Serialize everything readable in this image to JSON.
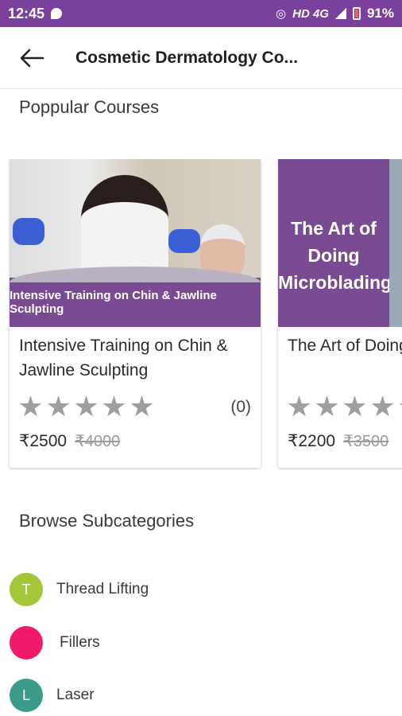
{
  "status_bar": {
    "time": "12:45",
    "network": "HD 4G",
    "battery": "91%",
    "background": "#7b3f9c"
  },
  "app_bar": {
    "back_icon": "arrow-left-icon",
    "title": "Cosmetic Dermatology Co..."
  },
  "popular": {
    "title": "Poppular Courses",
    "courses": [
      {
        "thumbnail_caption": "Intensive Training on Chin & Jawline Sculpting",
        "name": "Intensive Training on Chin & Jawline Sculpting",
        "rating": 0,
        "review_count": "(0)",
        "price": "₹2500",
        "old_price": "₹4000"
      },
      {
        "thumbnail_caption": "The Art of Doing Microblading",
        "name": "The Art of Doing Microblading",
        "rating": 0,
        "price": "₹2200",
        "old_price": "₹3500"
      }
    ]
  },
  "browse": {
    "title": "Browse Subcategories",
    "items": [
      {
        "initial": "T",
        "label": "Thread Lifting",
        "color": "#a4c639"
      },
      {
        "initial": "",
        "label": "Fillers",
        "color": "#f0196a"
      },
      {
        "initial": "L",
        "label": "Laser",
        "color": "#3b9b8a"
      }
    ]
  },
  "colors": {
    "accent": "#7b3f9c",
    "star_empty": "#9e9e9e"
  }
}
